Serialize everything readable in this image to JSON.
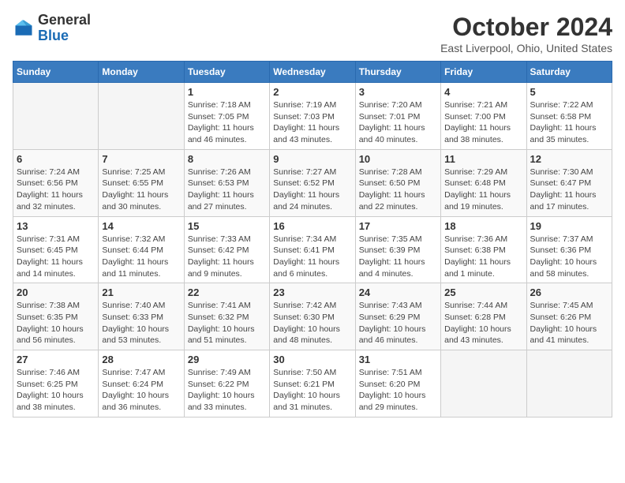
{
  "header": {
    "logo": {
      "line1": "General",
      "line2": "Blue"
    },
    "title": "October 2024",
    "subtitle": "East Liverpool, Ohio, United States"
  },
  "days_of_week": [
    "Sunday",
    "Monday",
    "Tuesday",
    "Wednesday",
    "Thursday",
    "Friday",
    "Saturday"
  ],
  "weeks": [
    [
      {
        "day": "",
        "info": ""
      },
      {
        "day": "",
        "info": ""
      },
      {
        "day": "1",
        "info": "Sunrise: 7:18 AM\nSunset: 7:05 PM\nDaylight: 11 hours and 46 minutes."
      },
      {
        "day": "2",
        "info": "Sunrise: 7:19 AM\nSunset: 7:03 PM\nDaylight: 11 hours and 43 minutes."
      },
      {
        "day": "3",
        "info": "Sunrise: 7:20 AM\nSunset: 7:01 PM\nDaylight: 11 hours and 40 minutes."
      },
      {
        "day": "4",
        "info": "Sunrise: 7:21 AM\nSunset: 7:00 PM\nDaylight: 11 hours and 38 minutes."
      },
      {
        "day": "5",
        "info": "Sunrise: 7:22 AM\nSunset: 6:58 PM\nDaylight: 11 hours and 35 minutes."
      }
    ],
    [
      {
        "day": "6",
        "info": "Sunrise: 7:24 AM\nSunset: 6:56 PM\nDaylight: 11 hours and 32 minutes."
      },
      {
        "day": "7",
        "info": "Sunrise: 7:25 AM\nSunset: 6:55 PM\nDaylight: 11 hours and 30 minutes."
      },
      {
        "day": "8",
        "info": "Sunrise: 7:26 AM\nSunset: 6:53 PM\nDaylight: 11 hours and 27 minutes."
      },
      {
        "day": "9",
        "info": "Sunrise: 7:27 AM\nSunset: 6:52 PM\nDaylight: 11 hours and 24 minutes."
      },
      {
        "day": "10",
        "info": "Sunrise: 7:28 AM\nSunset: 6:50 PM\nDaylight: 11 hours and 22 minutes."
      },
      {
        "day": "11",
        "info": "Sunrise: 7:29 AM\nSunset: 6:48 PM\nDaylight: 11 hours and 19 minutes."
      },
      {
        "day": "12",
        "info": "Sunrise: 7:30 AM\nSunset: 6:47 PM\nDaylight: 11 hours and 17 minutes."
      }
    ],
    [
      {
        "day": "13",
        "info": "Sunrise: 7:31 AM\nSunset: 6:45 PM\nDaylight: 11 hours and 14 minutes."
      },
      {
        "day": "14",
        "info": "Sunrise: 7:32 AM\nSunset: 6:44 PM\nDaylight: 11 hours and 11 minutes."
      },
      {
        "day": "15",
        "info": "Sunrise: 7:33 AM\nSunset: 6:42 PM\nDaylight: 11 hours and 9 minutes."
      },
      {
        "day": "16",
        "info": "Sunrise: 7:34 AM\nSunset: 6:41 PM\nDaylight: 11 hours and 6 minutes."
      },
      {
        "day": "17",
        "info": "Sunrise: 7:35 AM\nSunset: 6:39 PM\nDaylight: 11 hours and 4 minutes."
      },
      {
        "day": "18",
        "info": "Sunrise: 7:36 AM\nSunset: 6:38 PM\nDaylight: 11 hours and 1 minute."
      },
      {
        "day": "19",
        "info": "Sunrise: 7:37 AM\nSunset: 6:36 PM\nDaylight: 10 hours and 58 minutes."
      }
    ],
    [
      {
        "day": "20",
        "info": "Sunrise: 7:38 AM\nSunset: 6:35 PM\nDaylight: 10 hours and 56 minutes."
      },
      {
        "day": "21",
        "info": "Sunrise: 7:40 AM\nSunset: 6:33 PM\nDaylight: 10 hours and 53 minutes."
      },
      {
        "day": "22",
        "info": "Sunrise: 7:41 AM\nSunset: 6:32 PM\nDaylight: 10 hours and 51 minutes."
      },
      {
        "day": "23",
        "info": "Sunrise: 7:42 AM\nSunset: 6:30 PM\nDaylight: 10 hours and 48 minutes."
      },
      {
        "day": "24",
        "info": "Sunrise: 7:43 AM\nSunset: 6:29 PM\nDaylight: 10 hours and 46 minutes."
      },
      {
        "day": "25",
        "info": "Sunrise: 7:44 AM\nSunset: 6:28 PM\nDaylight: 10 hours and 43 minutes."
      },
      {
        "day": "26",
        "info": "Sunrise: 7:45 AM\nSunset: 6:26 PM\nDaylight: 10 hours and 41 minutes."
      }
    ],
    [
      {
        "day": "27",
        "info": "Sunrise: 7:46 AM\nSunset: 6:25 PM\nDaylight: 10 hours and 38 minutes."
      },
      {
        "day": "28",
        "info": "Sunrise: 7:47 AM\nSunset: 6:24 PM\nDaylight: 10 hours and 36 minutes."
      },
      {
        "day": "29",
        "info": "Sunrise: 7:49 AM\nSunset: 6:22 PM\nDaylight: 10 hours and 33 minutes."
      },
      {
        "day": "30",
        "info": "Sunrise: 7:50 AM\nSunset: 6:21 PM\nDaylight: 10 hours and 31 minutes."
      },
      {
        "day": "31",
        "info": "Sunrise: 7:51 AM\nSunset: 6:20 PM\nDaylight: 10 hours and 29 minutes."
      },
      {
        "day": "",
        "info": ""
      },
      {
        "day": "",
        "info": ""
      }
    ]
  ]
}
